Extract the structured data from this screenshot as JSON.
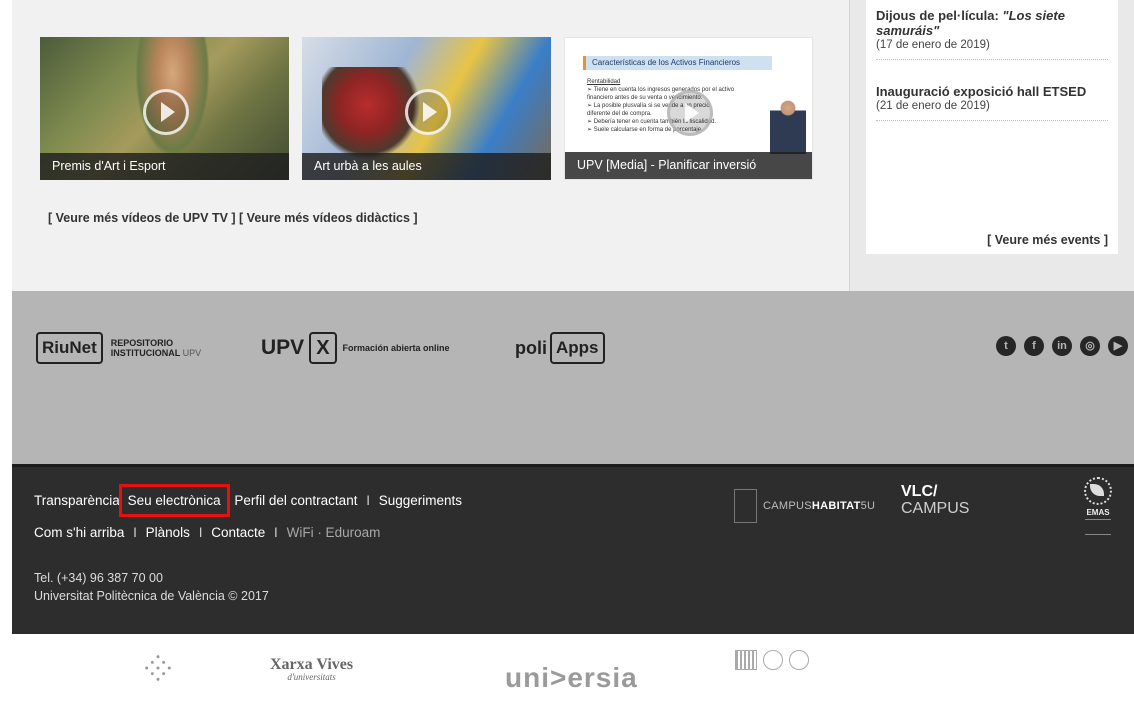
{
  "videos": [
    {
      "caption": "Premis d'Art i Esport"
    },
    {
      "caption": "Art urbà a les aules"
    },
    {
      "caption": "UPV [Media] - Planificar inversió",
      "slide_title": "Características de los Activos Financieros",
      "slide_lines": [
        "Rentabilidad",
        "➢ Tiene en cuenta los ingresos generados por el activo",
        "financiero antes de su venta o vencimiento.",
        "➢ La posible plusvalía si se vende a un precio",
        "diferente del de compra.",
        "➢ Debería tener en cuenta también la fiscalidad.",
        "➢ Suele calcularse en forma de porcentaje."
      ]
    }
  ],
  "more_videos": "[ Veure més vídeos de UPV TV ] [ Veure més vídeos didàctics ]",
  "events": [
    {
      "title_prefix": "Dijous de pel·lícula: ",
      "title_em": "\"Los siete samuráis\"",
      "date": "(17 de enero de 2019)"
    },
    {
      "title_prefix": "Inauguració exposició hall ETSED",
      "title_em": "",
      "date": "(21 de enero de 2019)"
    }
  ],
  "more_events": "[ Veure més events ]",
  "partners": {
    "riunet": "RiuNet",
    "riunet_sub1": "REPOSITORIO",
    "riunet_sub2": "INSTITUCIONAL",
    "riunet_sub3": "UPV",
    "upv": "UPV",
    "x": "X",
    "upvx_sub": "Formación abierta online",
    "poli": "poli",
    "apps": "Apps"
  },
  "social": [
    {
      "icon": "twitter-icon",
      "glyph": "t"
    },
    {
      "icon": "facebook-icon",
      "glyph": "f"
    },
    {
      "icon": "linkedin-icon",
      "glyph": "in"
    },
    {
      "icon": "instagram-icon",
      "glyph": "◎"
    },
    {
      "icon": "youtube-icon",
      "glyph": "▶"
    }
  ],
  "footer": {
    "links_row1": [
      "Transparència",
      "Seu electrònica",
      "Perfil del contractant",
      "Suggeriments"
    ],
    "links_row2": [
      "Com s'hi arriba",
      "Plànols",
      "Contacte"
    ],
    "wifi": "WiFi · Eduroam",
    "separator": "I",
    "tel": "Tel. (+34) 96 387 70 00",
    "copyright": "Universitat Politècnica de València © 2017",
    "campus_light": "CAMPUS",
    "campus_bold": "HABITAT",
    "campus_suffix": "5U",
    "vlc": "VLC/",
    "vlc_campus": "CAMPUS",
    "emas": "EMAS"
  },
  "bottom_logos": {
    "xarxa": "Xarxa Vives",
    "xarxa_sub": "d'universitats",
    "universia": "uni>ersia"
  },
  "colors": {
    "highlight": "#e80f0f",
    "grey_band": "#b5b5b5",
    "dark_footer": "#2d2d2d"
  }
}
